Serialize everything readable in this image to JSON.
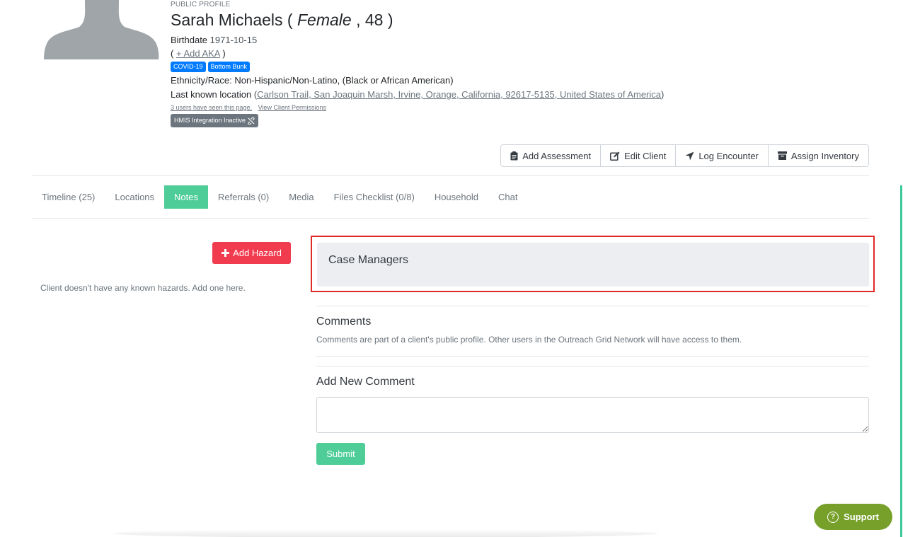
{
  "profile": {
    "eyebrow": "PUBLIC PROFILE",
    "name": "Sarah Michaels",
    "gender": "Female",
    "age": "48",
    "birthdate_label": "Birthdate",
    "birthdate": "1971-10-15",
    "add_aka": "+ Add AKA",
    "badges": [
      "COVID-19",
      "Bottom Bunk"
    ],
    "ethnicity_label": "Ethnicity/Race:",
    "ethnicity": "Non-Hispanic/Non-Latino, (Black or African American)",
    "location_label": "Last known location",
    "location": "Carlson Trail, San Joaquin Marsh, Irvine, Orange, California, 92617-5135, United States of America",
    "seen_by": "3 users have seen this page.",
    "permissions_link": "View Client Permissions",
    "hmis": "HMIS Integration Inactive"
  },
  "actions": {
    "add_assessment": "Add Assessment",
    "edit_client": "Edit Client",
    "log_encounter": "Log Encounter",
    "assign_inventory": "Assign Inventory"
  },
  "tabs": [
    {
      "label": "Timeline (25)"
    },
    {
      "label": "Locations"
    },
    {
      "label": "Notes"
    },
    {
      "label": "Referrals (0)"
    },
    {
      "label": "Media"
    },
    {
      "label": "Files Checklist (0/8)"
    },
    {
      "label": "Household"
    },
    {
      "label": "Chat"
    }
  ],
  "hazards": {
    "add_label": "Add Hazard",
    "empty_text": "Client doesn't have any known hazards. Add one here."
  },
  "case_managers": {
    "title": "Case Managers"
  },
  "comments": {
    "title": "Comments",
    "description": "Comments are part of a client's public profile. Other users in the Outreach Grid Network will have access to them.",
    "new_title": "Add New Comment",
    "textarea_value": "",
    "submit": "Submit"
  },
  "support": {
    "label": "Support"
  },
  "colors": {
    "accent": "#4fcd98",
    "danger": "#f13c4f",
    "badge": "#007bff",
    "support": "#77a02a",
    "highlight": "#e02a2a"
  }
}
